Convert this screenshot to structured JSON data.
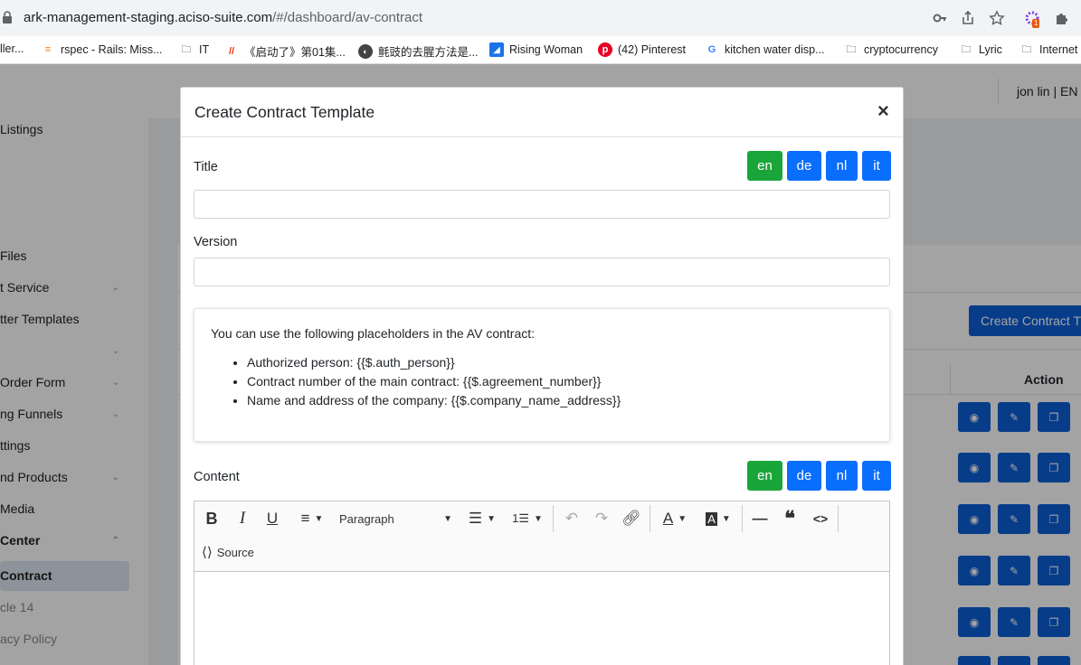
{
  "browser": {
    "url_host": "ark-management-staging.aciso-suite.com",
    "url_path": "/#/dashboard/av-contract",
    "bookmarks": [
      {
        "label": "ller...",
        "icon": "page-icon"
      },
      {
        "label": "rspec - Rails: Miss...",
        "icon": "stackoverflow-icon"
      },
      {
        "label": "IT",
        "icon": "folder-icon"
      },
      {
        "label": "《启动了》第01集...",
        "icon": "site-icon"
      },
      {
        "label": "氈豉的去腥方法是...",
        "icon": "globe-icon"
      },
      {
        "label": "Rising Woman",
        "icon": "site-icon"
      },
      {
        "label": "(42) Pinterest",
        "icon": "pinterest-icon"
      },
      {
        "label": "kitchen water disp...",
        "icon": "google-icon"
      },
      {
        "label": "cryptocurrency",
        "icon": "folder-icon"
      },
      {
        "label": "Lyric",
        "icon": "folder-icon"
      },
      {
        "label": "Internet",
        "icon": "folder-icon"
      }
    ],
    "extension_badge": "1"
  },
  "app": {
    "user": "jon lin |",
    "lang": "EN",
    "create_button": "Create Contract T",
    "action_header": "Action",
    "sidebar": [
      {
        "label": "Listings",
        "type": "item"
      },
      {
        "label": "Files",
        "type": "item"
      },
      {
        "label": "t Service",
        "type": "item"
      },
      {
        "label": "tter Templates",
        "type": "item"
      },
      {
        "label": "",
        "type": "item"
      },
      {
        "label": "Order Form",
        "type": "item"
      },
      {
        "label": "ng Funnels",
        "type": "item"
      },
      {
        "label": "ttings",
        "type": "item"
      },
      {
        "label": "nd Products",
        "type": "item"
      },
      {
        "label": "Media",
        "type": "item"
      },
      {
        "label": "Center",
        "type": "section"
      },
      {
        "label": "Contract",
        "type": "active"
      },
      {
        "label": "cle 14",
        "type": "muted"
      },
      {
        "label": "acy Policy",
        "type": "muted"
      }
    ]
  },
  "modal": {
    "title": "Create Contract Template",
    "close": "×",
    "title_label": "Title",
    "version_label": "Version",
    "title_value": "",
    "version_value": "",
    "languages": [
      "en",
      "de",
      "nl",
      "it"
    ],
    "info": {
      "intro": "You can use the following placeholders in the AV contract:",
      "items": [
        "Authorized person: {{$.auth_person}}",
        "Contract number of the main contract: {{$.agreement_number}}",
        "Name and address of the company: {{$.company_name_address}}"
      ]
    },
    "content_label": "Content",
    "editor": {
      "heading_select": "Paragraph",
      "source_label": "Source"
    }
  }
}
